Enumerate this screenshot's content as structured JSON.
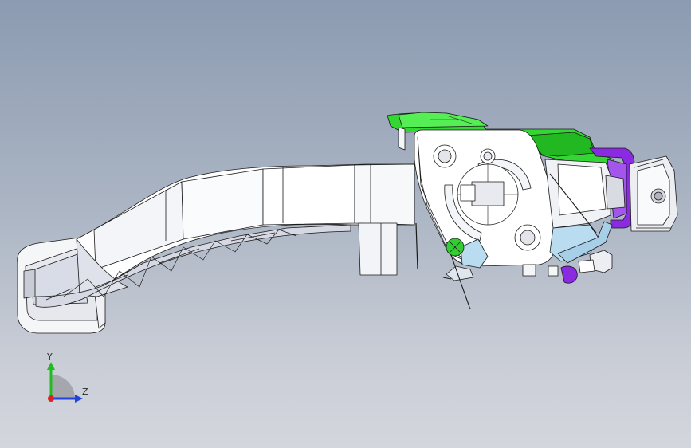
{
  "viewport": {
    "background_top": "#8c9bb1",
    "background_bottom": "#d3d6dd"
  },
  "model": {
    "parts": [
      {
        "name": "pedal-arm",
        "color": "#ffffff"
      },
      {
        "name": "pedal-pad",
        "color": "#ffffff"
      },
      {
        "name": "mounting-bracket",
        "color": "#ffffff"
      },
      {
        "name": "top-clip",
        "color": "#22cc22"
      },
      {
        "name": "rear-clip",
        "color": "#8a2be2"
      },
      {
        "name": "spring-bracket",
        "color": "#b9dcf0"
      },
      {
        "name": "screw-head",
        "color": "#33cc33"
      }
    ],
    "edge_color": "#1a1a1a"
  },
  "triad": {
    "y_label": "Y",
    "z_label": "Z",
    "y_color": "#22bb22",
    "z_color": "#2244dd",
    "x_color": "#dd2222"
  }
}
